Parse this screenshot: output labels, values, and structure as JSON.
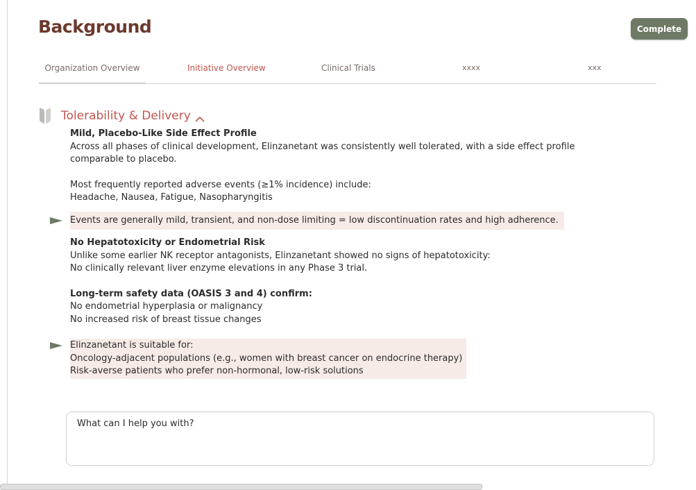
{
  "header": {
    "title": "Background",
    "complete_label": "Complete"
  },
  "tabs": [
    {
      "label": "Organization Overview"
    },
    {
      "label": "Initiative Overview"
    },
    {
      "label": "Clinical Trials"
    },
    {
      "label": "xxxx"
    },
    {
      "label": "xxx"
    }
  ],
  "section": {
    "title": "Tolerability & Delivery",
    "icon": "bookmark-icon",
    "toggle_icon": "chevron-up-icon"
  },
  "content": {
    "block1": {
      "heading": "Mild, Placebo-Like Side Effect Profile",
      "line1": "Across all phases of clinical development, Elinzanetant was consistently well tolerated, with a side effect profile",
      "line2": "comparable to placebo."
    },
    "block2": {
      "line1": "Most frequently reported adverse events (≥1% incidence) include:",
      "line2": "Headache, Nausea, Fatigue, Nasopharyngitis"
    },
    "callout1": "Events are generally mild, transient, and non-dose limiting = low discontinuation rates and high adherence.",
    "block3": {
      "heading": "No Hepatotoxicity or Endometrial Risk",
      "line1": "Unlike some earlier NK receptor antagonists, Elinzanetant showed no signs of hepatotoxicity:",
      "line2": "No clinically relevant liver enzyme elevations in any Phase 3 trial."
    },
    "block4": {
      "heading": "Long-term safety data (OASIS 3 and 4) confirm:",
      "line1": "No endometrial hyperplasia or malignancy",
      "line2": "No increased risk of breast tissue changes"
    },
    "callout2": {
      "line1": "Elinzanetant is suitable for:",
      "line2": "Oncology-adjacent populations (e.g., women with breast cancer on endocrine therapy)",
      "line3": "Risk-averse patients who prefer non-hormonal, low-risk solutions"
    }
  },
  "chat": {
    "placeholder": "What can I help you with?"
  },
  "colors": {
    "title": "#6b3a2e",
    "accent": "#c0564e",
    "button": "#6e7a66",
    "highlight": "#f6ebe7",
    "flag": "#6e7a66"
  }
}
